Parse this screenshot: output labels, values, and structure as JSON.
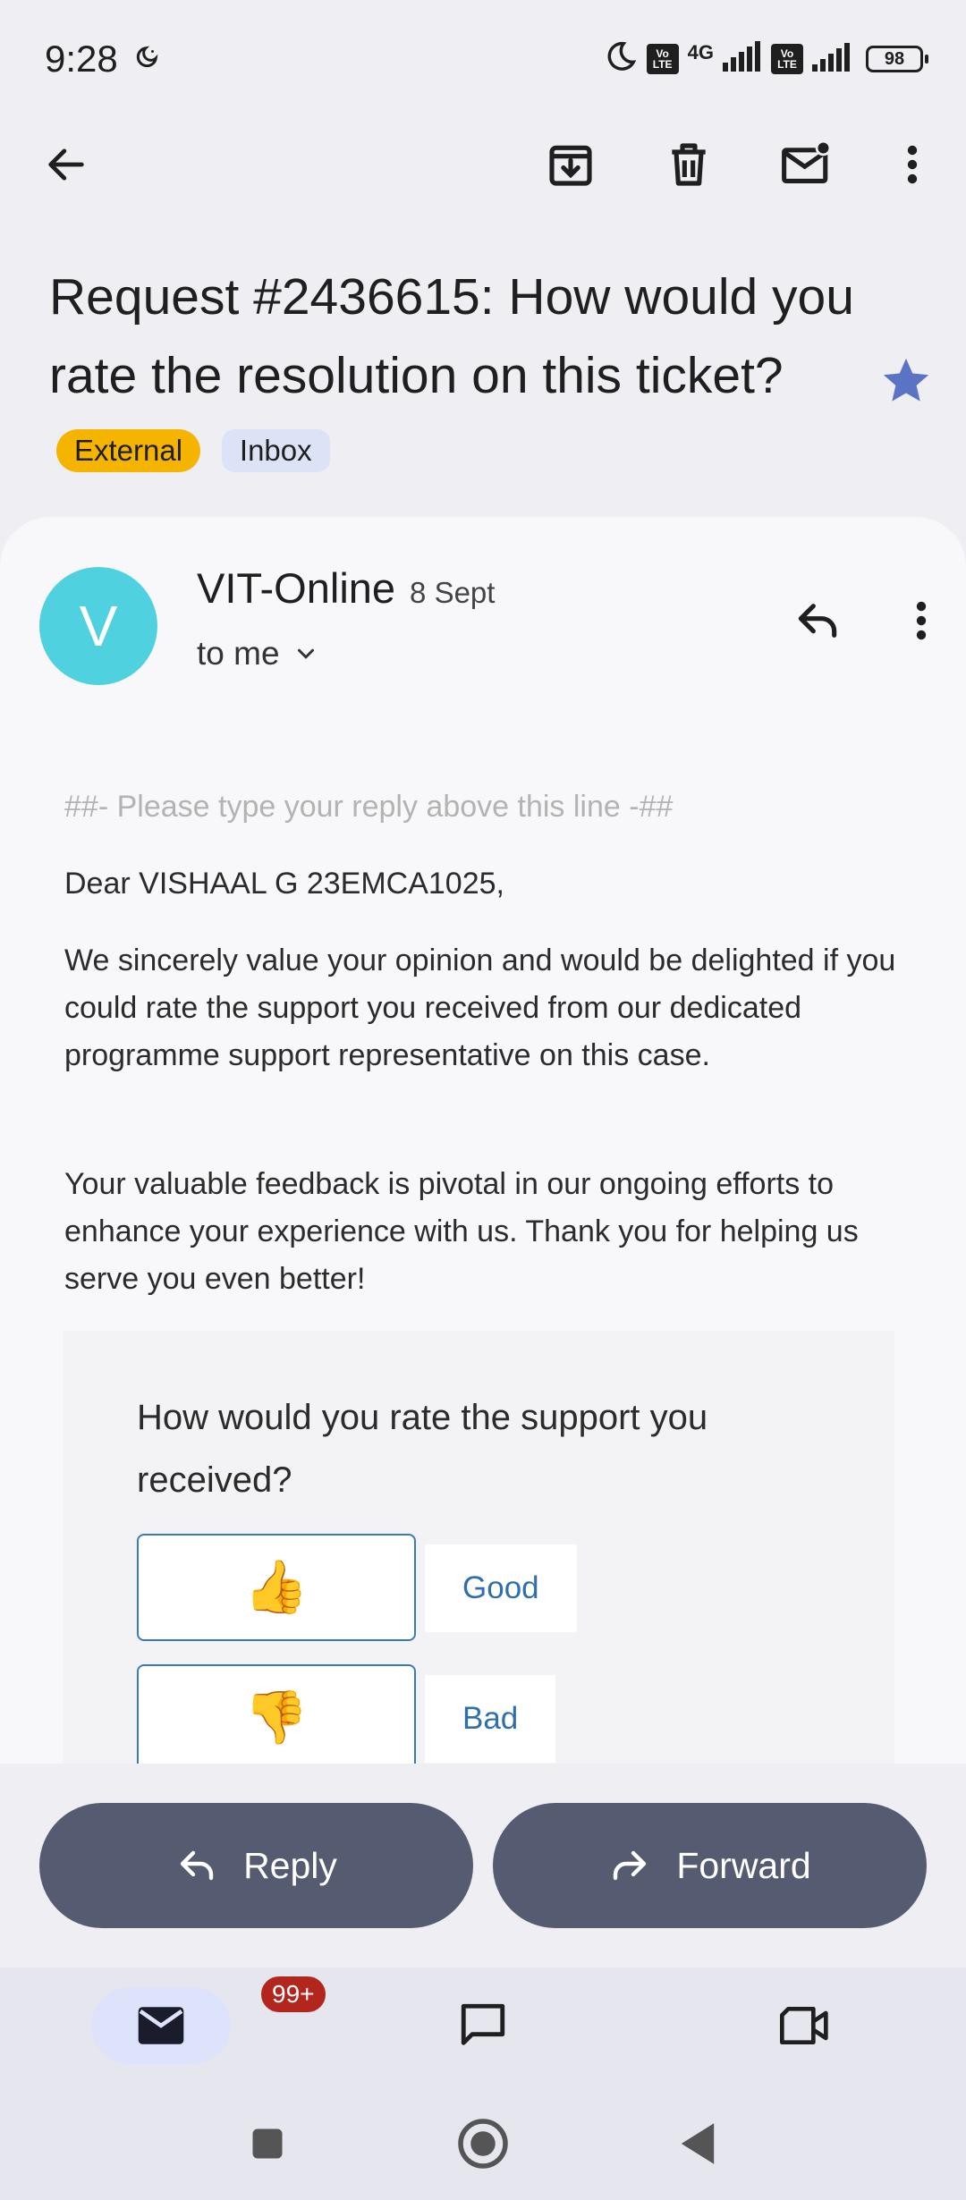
{
  "status_bar": {
    "time": "9:28",
    "network": "4G",
    "volte_1": "Vo LTE",
    "volte_2": "Vo LTE",
    "battery": "98"
  },
  "toolbar": {
    "icons": [
      "back-arrow-icon",
      "archive-icon",
      "delete-icon",
      "mark-unread-icon",
      "more-vert-icon"
    ]
  },
  "email": {
    "subject": "Request #2436615: How would you rate the resolution on this ticket?",
    "labels": [
      "External",
      "Inbox"
    ],
    "starred": true,
    "sender": "VIT-Online",
    "avatar_initial": "V",
    "avatar_color": "#4fd1e0",
    "date": "8 Sept",
    "recipient": "to me",
    "body": {
      "placeholder_line": "##- Please type your reply above this line -##",
      "greeting": "Dear VISHAAL G 23EMCA1025,",
      "paragraph1": "We sincerely value your opinion and would be delighted if you could rate the support you received from our dedicated programme support representative on this case.",
      "paragraph2": "Your valuable feedback is pivotal in our ongoing efforts to enhance your experience with us. Thank you for helping us serve you even better!",
      "rating_question": "How would you rate the support you received?",
      "good_emoji": "👍",
      "good_label": "Good",
      "bad_emoji": "👎",
      "bad_label": "Bad"
    }
  },
  "actions": {
    "reply": "Reply",
    "forward": "Forward"
  },
  "bottom_nav": {
    "mail_badge": "99+",
    "items": [
      "mail-icon",
      "chat-icon",
      "meet-icon"
    ]
  },
  "colors": {
    "accent_blue": "#2f6fae",
    "pill_bg": "#555b70",
    "external_chip": "#f4b400",
    "inbox_chip": "#dde3f7",
    "star": "#5b73c4",
    "badge": "#b3261e"
  }
}
